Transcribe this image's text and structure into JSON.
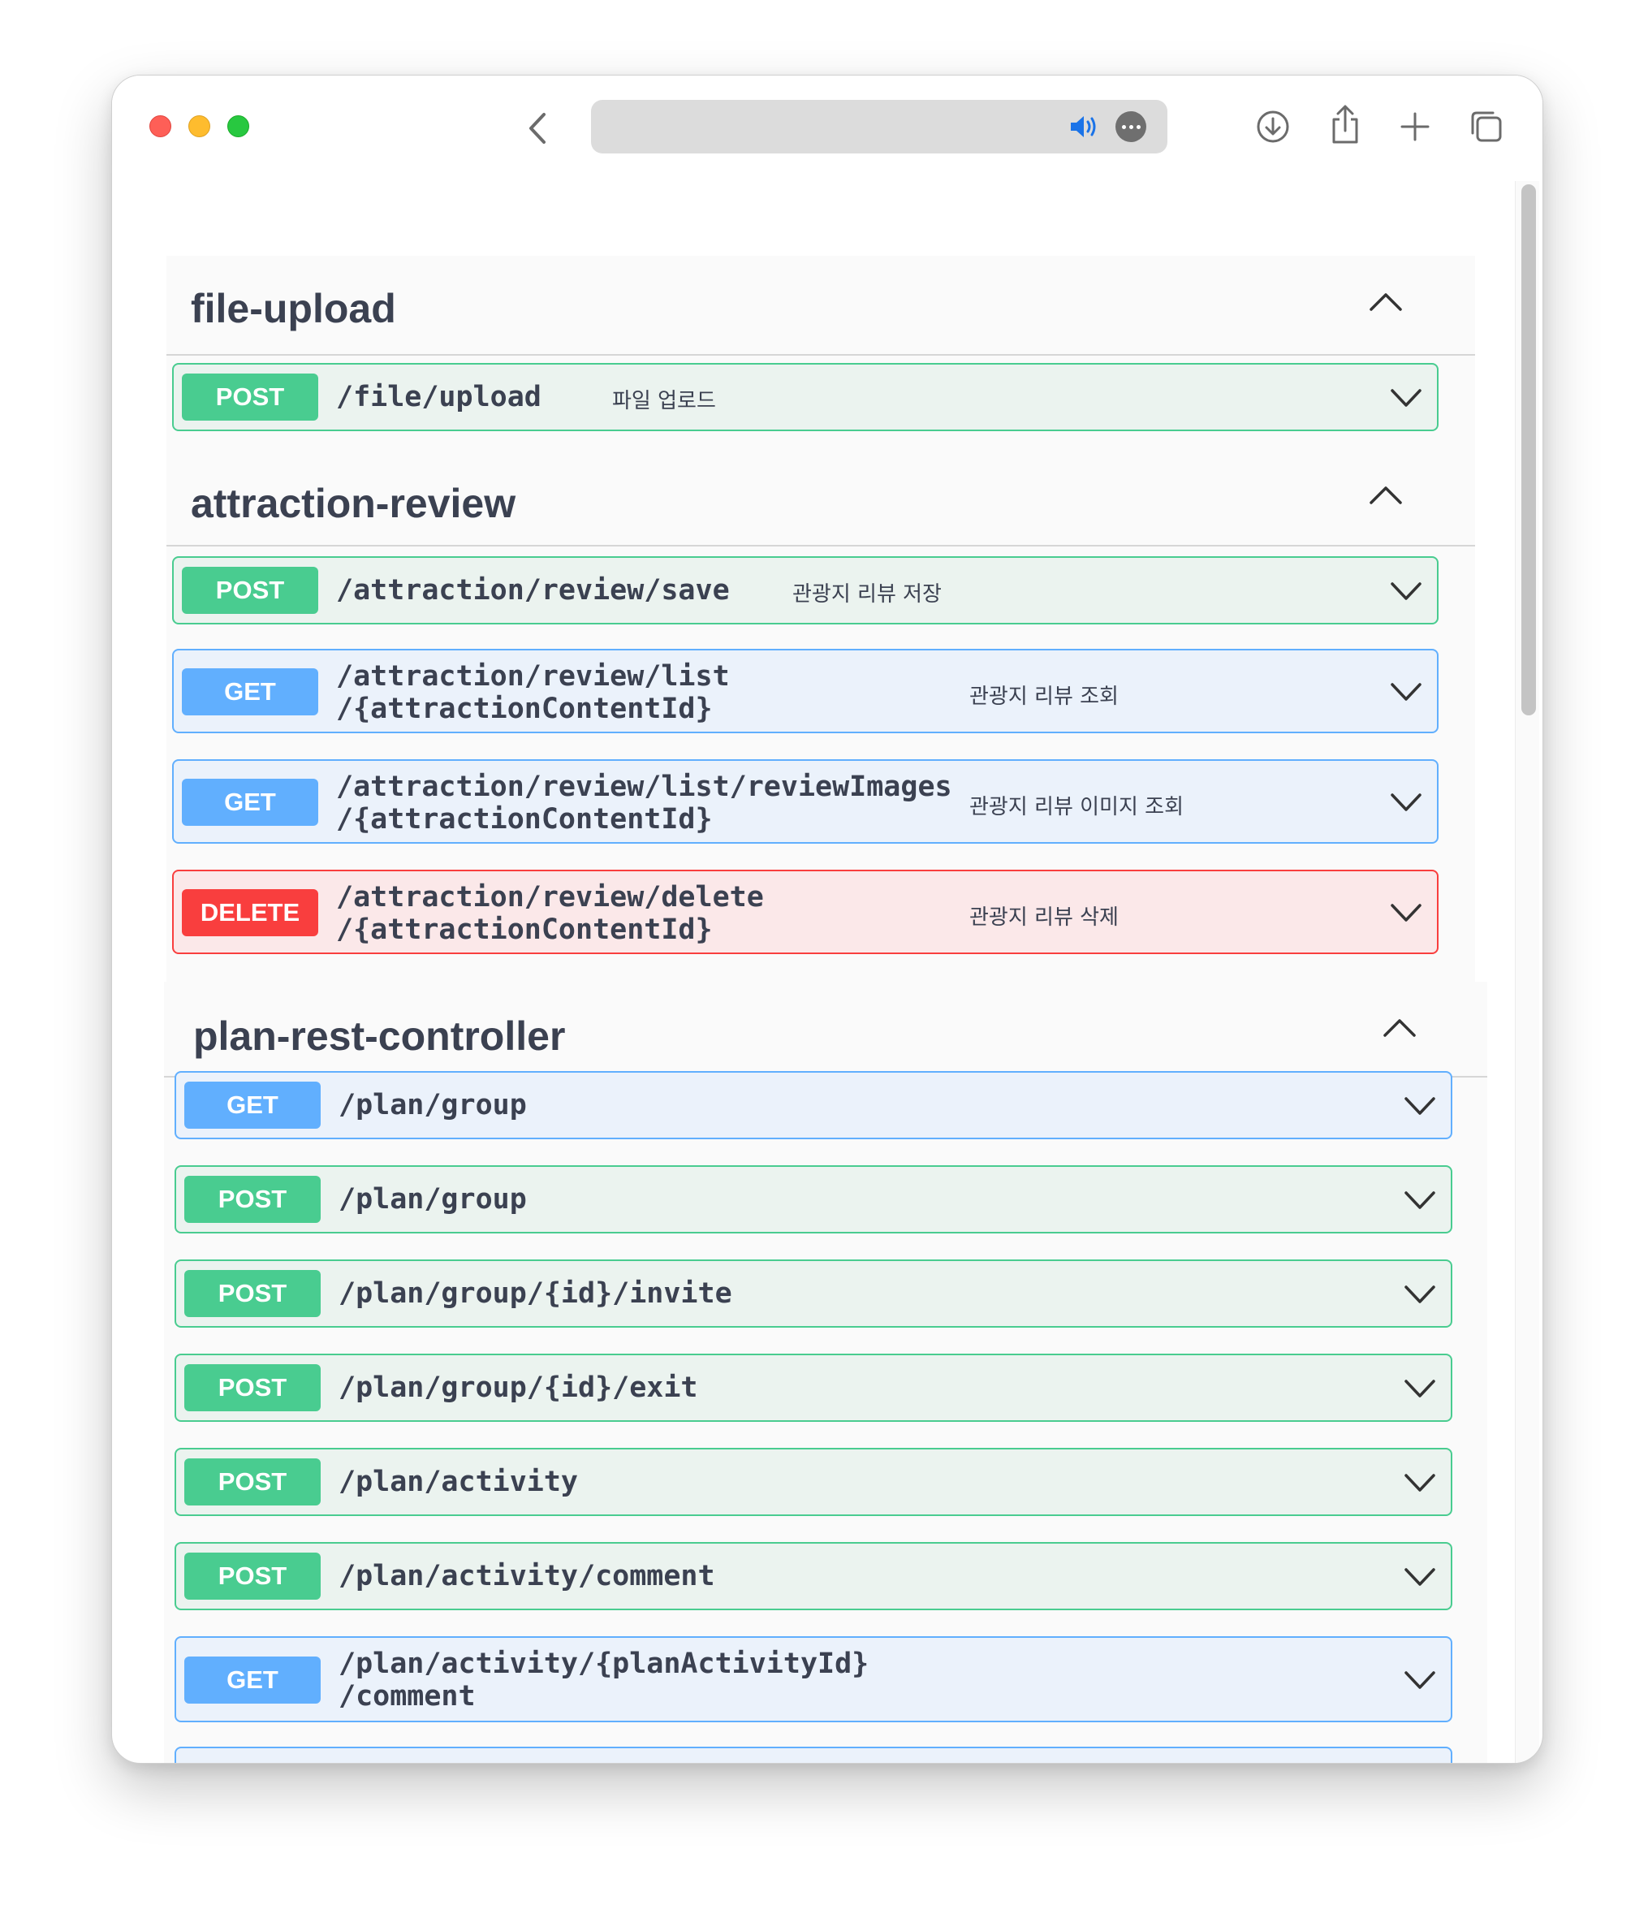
{
  "browser": {
    "address_text": ""
  },
  "sections": [
    {
      "title": "file-upload",
      "operations": [
        {
          "method": "POST",
          "path": "/file/upload",
          "summary": "파일 업로드"
        }
      ]
    },
    {
      "title": "attraction-review",
      "operations": [
        {
          "method": "POST",
          "path": "/attraction/review/save",
          "summary": "관광지 리뷰 저장"
        },
        {
          "method": "GET",
          "path": "/attraction/review/list\n/{attractionContentId}",
          "summary": "관광지 리뷰 조회"
        },
        {
          "method": "GET",
          "path": "/attraction/review/list/reviewImages\n/{attractionContentId}",
          "summary": "관광지 리뷰 이미지 조회"
        },
        {
          "method": "DELETE",
          "path": "/attraction/review/delete\n/{attractionContentId}",
          "summary": "관광지 리뷰 삭제"
        }
      ]
    },
    {
      "title": "plan-rest-controller",
      "operations": [
        {
          "method": "GET",
          "path": "/plan/group",
          "summary": ""
        },
        {
          "method": "POST",
          "path": "/plan/group",
          "summary": ""
        },
        {
          "method": "POST",
          "path": "/plan/group/{id}/invite",
          "summary": ""
        },
        {
          "method": "POST",
          "path": "/plan/group/{id}/exit",
          "summary": ""
        },
        {
          "method": "POST",
          "path": "/plan/activity",
          "summary": ""
        },
        {
          "method": "POST",
          "path": "/plan/activity/comment",
          "summary": ""
        },
        {
          "method": "GET",
          "path": "/plan/activity/{planActivityId}\n/comment",
          "summary": ""
        }
      ]
    }
  ],
  "icons": {
    "back": "chevron-left-icon",
    "speaker": "speaker-icon",
    "more": "more-icon",
    "download": "download-icon",
    "share": "share-icon",
    "new_tab": "plus-icon",
    "tabs": "tabs-overview-icon",
    "collapse": "chevron-up-icon",
    "expand": "chevron-down-icon"
  },
  "colors": {
    "post": "#49cc90",
    "get": "#61affe",
    "delete": "#f93e3e",
    "text": "#3b4151"
  }
}
